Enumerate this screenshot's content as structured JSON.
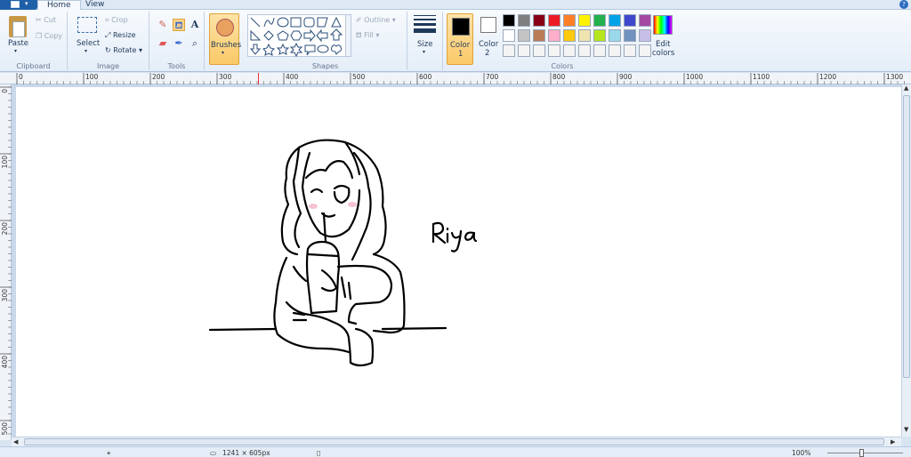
{
  "tabs": {
    "home": "Home",
    "view": "View"
  },
  "help": "?",
  "clipboard": {
    "paste": "Paste",
    "cut": "Cut",
    "copy": "Copy",
    "group": "Clipboard"
  },
  "image": {
    "select": "Select",
    "crop": "Crop",
    "resize": "Resize",
    "rotate": "Rotate",
    "group": "Image"
  },
  "tools": {
    "group": "Tools",
    "text_glyph": "A"
  },
  "brushes": {
    "label": "Brushes"
  },
  "shapes": {
    "group": "Shapes",
    "outline": "Outline",
    "fill": "Fill"
  },
  "size": {
    "label": "Size"
  },
  "colors": {
    "color1_label": "Color",
    "color1_num": "1",
    "color2_label": "Color",
    "color2_num": "2",
    "edit_label": "Edit",
    "edit_label2": "colors",
    "group": "Colors",
    "row1": [
      "#000000",
      "#7f7f7f",
      "#880015",
      "#ed1c24",
      "#ff7f27",
      "#fff200",
      "#22b14c",
      "#00a2e8",
      "#3f48cc",
      "#a349a4"
    ],
    "row2": [
      "#ffffff",
      "#c3c3c3",
      "#b97a57",
      "#ffaec9",
      "#ffc90e",
      "#efe4b0",
      "#b5e61d",
      "#99d9ea",
      "#7092be",
      "#c8bfe7"
    ],
    "row3": [
      "#f4f4f4",
      "#f4f4f4",
      "#f4f4f4",
      "#f4f4f4",
      "#f4f4f4",
      "#f4f4f4",
      "#f4f4f4",
      "#f4f4f4",
      "#f4f4f4",
      "#f4f4f4"
    ]
  },
  "ruler": {
    "top": [
      "0",
      "100",
      "200",
      "300",
      "400",
      "500",
      "600",
      "700",
      "800",
      "900",
      "1000",
      "1100",
      "1200",
      "1300"
    ],
    "left": [
      "0",
      "100",
      "200",
      "300",
      "400",
      "500"
    ]
  },
  "drawing": {
    "name_text": "Riya"
  },
  "statusbar": {
    "canvas_size": "1241 × 605px",
    "zoom": "100%"
  }
}
